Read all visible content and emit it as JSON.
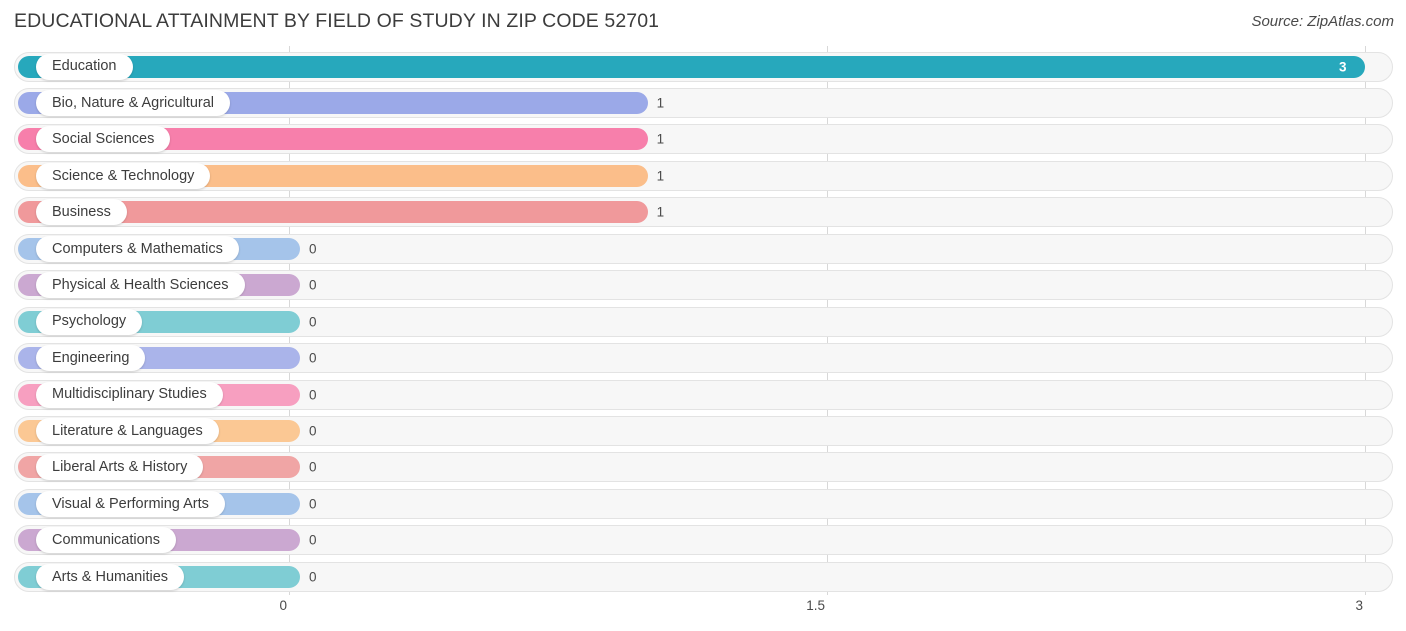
{
  "header": {
    "title": "EDUCATIONAL ATTAINMENT BY FIELD OF STUDY IN ZIP CODE 52701",
    "source": "Source: ZipAtlas.com"
  },
  "chart_data": {
    "type": "bar",
    "orientation": "horizontal",
    "title": "EDUCATIONAL ATTAINMENT BY FIELD OF STUDY IN ZIP CODE 52701",
    "xlabel": "",
    "ylabel": "",
    "xlim": [
      0,
      3
    ],
    "xticks": [
      "0",
      "1.5",
      "3"
    ],
    "xtick_values": [
      0,
      1.5,
      3
    ],
    "grid": true,
    "legend": "none",
    "categories": [
      "Education",
      "Bio, Nature & Agricultural",
      "Social Sciences",
      "Science & Technology",
      "Business",
      "Computers & Mathematics",
      "Physical & Health Sciences",
      "Psychology",
      "Engineering",
      "Multidisciplinary Studies",
      "Literature & Languages",
      "Liberal Arts & History",
      "Visual & Performing Arts",
      "Communications",
      "Arts & Humanities"
    ],
    "values": [
      3,
      1,
      1,
      1,
      1,
      0,
      0,
      0,
      0,
      0,
      0,
      0,
      0,
      0,
      0
    ],
    "value_labels": [
      "3",
      "1",
      "1",
      "1",
      "1",
      "0",
      "0",
      "0",
      "0",
      "0",
      "0",
      "0",
      "0",
      "0",
      "0"
    ],
    "colors": [
      "#27a8bc",
      "#9ba9e8",
      "#f77fab",
      "#fbbe8a",
      "#f0999b",
      "#a5c4ea",
      "#cba8d1",
      "#7fcdd4",
      "#aab4ea",
      "#f79fc0",
      "#fbc894",
      "#f0a5a5",
      "#a5c4ea",
      "#cba8d1",
      "#7fcdd4"
    ]
  },
  "palette": {
    "track_fill": "#f7f7f7",
    "track_border": "#e3e3e3",
    "gridline": "#d8d8d8",
    "text": "#3d3d3d"
  }
}
